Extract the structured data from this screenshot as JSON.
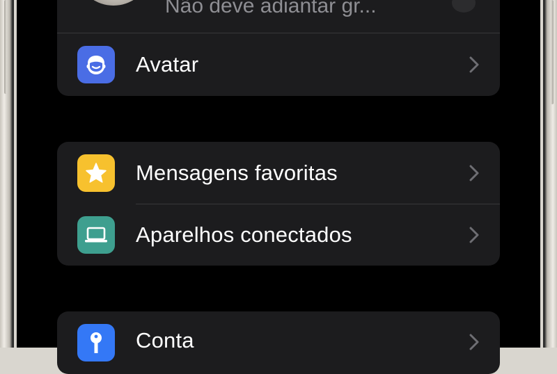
{
  "profile": {
    "status_text": "Não deve adiantar gr...",
    "avatar_icon": "profile-photo"
  },
  "groups": [
    {
      "items": [
        {
          "label": "Avatar",
          "icon": "avatar-icon",
          "icon_bg": "#4a6de5"
        }
      ]
    },
    {
      "items": [
        {
          "label": "Mensagens favoritas",
          "icon": "star-icon",
          "icon_bg": "#f7c12e"
        },
        {
          "label": "Aparelhos conectados",
          "icon": "laptop-icon",
          "icon_bg": "#3e9f8f"
        }
      ]
    },
    {
      "items": [
        {
          "label": "Conta",
          "icon": "key-icon",
          "icon_bg": "#3478f6"
        }
      ]
    }
  ],
  "colors": {
    "background": "#000000",
    "group_bg": "#1c1c1e",
    "chevron": "#6e6e73",
    "text": "#ffffff",
    "secondary_text": "#8e8e93"
  }
}
